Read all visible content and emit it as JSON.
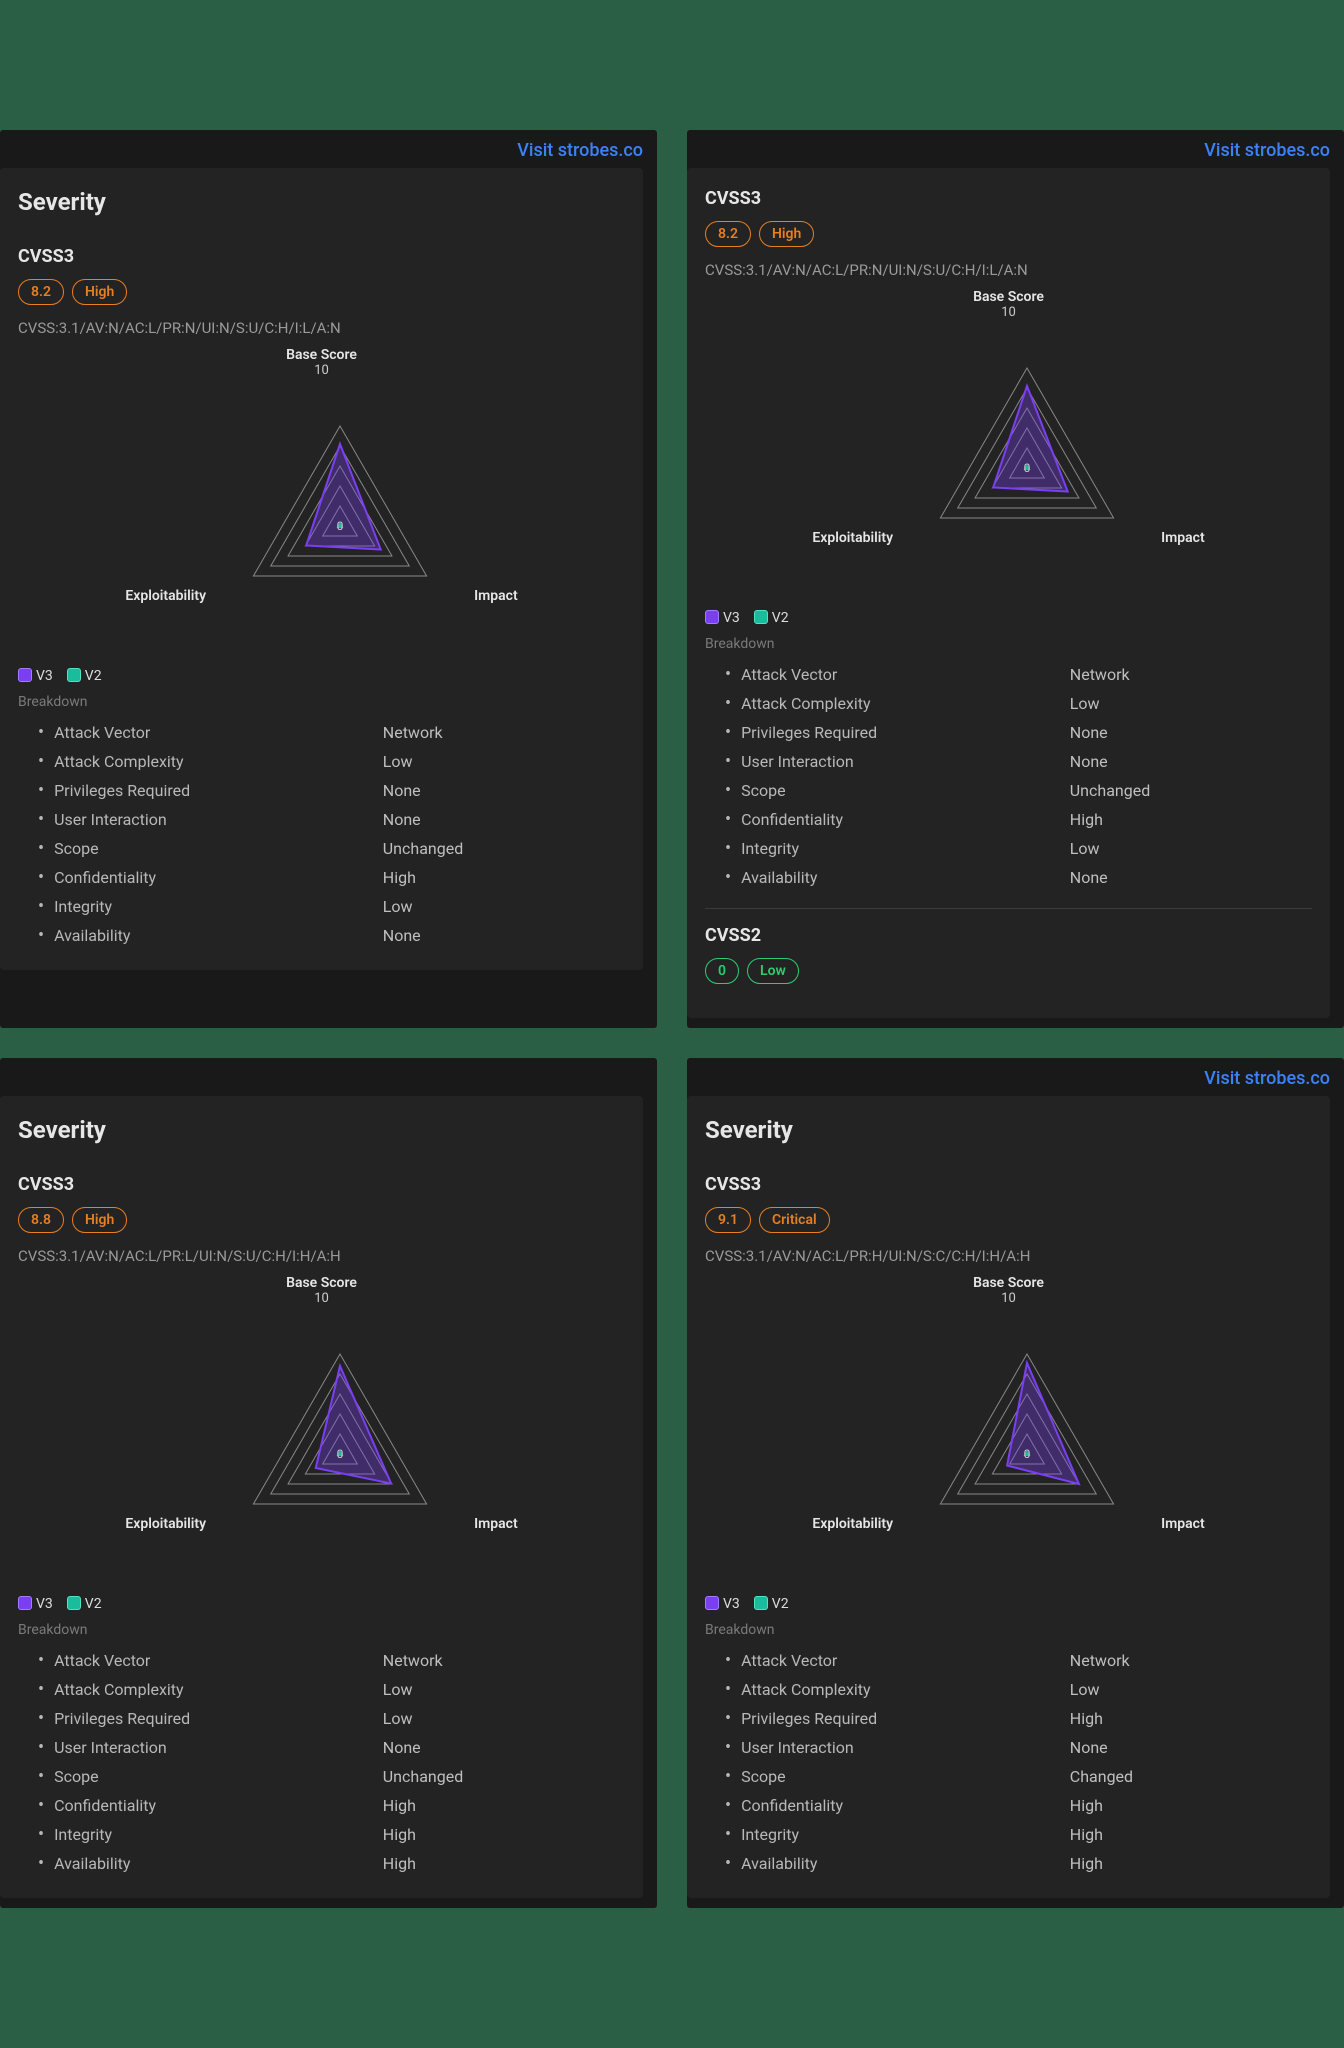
{
  "common": {
    "visit_link": "Visit strobes.co",
    "severity_title": "Severity",
    "cvss3_title": "CVSS3",
    "cvss2_title": "CVSS2",
    "breakdown_heading": "Breakdown",
    "legend_v3": "V3",
    "legend_v2": "V2",
    "radar_top_label": "Base Score",
    "radar_max": "10",
    "radar_left": "Exploitability",
    "radar_right": "Impact",
    "radar_center": "0",
    "colors": {
      "v3": "#7b3ff2",
      "v2": "#1abc9c",
      "orange": "#e67e22",
      "green": "#2ecc71"
    }
  },
  "panels": [
    {
      "show_visit": true,
      "show_severity_title": true,
      "cvss3": {
        "score": "8.2",
        "severity": "High",
        "severity_color": "orange",
        "vector": "CVSS:3.1/AV:N/AC:L/PR:N/UI:N/S:U/C:H/I:L/A:N",
        "breakdown": [
          {
            "label": "Attack Vector",
            "value": "Network"
          },
          {
            "label": "Attack Complexity",
            "value": "Low"
          },
          {
            "label": "Privileges Required",
            "value": "None"
          },
          {
            "label": "User Interaction",
            "value": "None"
          },
          {
            "label": "Scope",
            "value": "Unchanged"
          },
          {
            "label": "Confidentiality",
            "value": "High"
          },
          {
            "label": "Integrity",
            "value": "Low"
          },
          {
            "label": "Availability",
            "value": "None"
          }
        ]
      }
    },
    {
      "show_visit": true,
      "show_severity_title": false,
      "cvss3": {
        "score": "8.2",
        "severity": "High",
        "severity_color": "orange",
        "vector": "CVSS:3.1/AV:N/AC:L/PR:N/UI:N/S:U/C:H/I:L/A:N",
        "breakdown": [
          {
            "label": "Attack Vector",
            "value": "Network"
          },
          {
            "label": "Attack Complexity",
            "value": "Low"
          },
          {
            "label": "Privileges Required",
            "value": "None"
          },
          {
            "label": "User Interaction",
            "value": "None"
          },
          {
            "label": "Scope",
            "value": "Unchanged"
          },
          {
            "label": "Confidentiality",
            "value": "High"
          },
          {
            "label": "Integrity",
            "value": "Low"
          },
          {
            "label": "Availability",
            "value": "None"
          }
        ]
      },
      "cvss2": {
        "score": "0",
        "severity": "Low",
        "severity_color": "green"
      }
    },
    {
      "show_visit": false,
      "show_severity_title": true,
      "cvss3": {
        "score": "8.8",
        "severity": "High",
        "severity_color": "orange",
        "vector": "CVSS:3.1/AV:N/AC:L/PR:L/UI:N/S:U/C:H/I:H/A:H",
        "breakdown": [
          {
            "label": "Attack Vector",
            "value": "Network"
          },
          {
            "label": "Attack Complexity",
            "value": "Low"
          },
          {
            "label": "Privileges Required",
            "value": "Low"
          },
          {
            "label": "User Interaction",
            "value": "None"
          },
          {
            "label": "Scope",
            "value": "Unchanged"
          },
          {
            "label": "Confidentiality",
            "value": "High"
          },
          {
            "label": "Integrity",
            "value": "High"
          },
          {
            "label": "Availability",
            "value": "High"
          }
        ]
      }
    },
    {
      "show_visit": true,
      "show_severity_title": true,
      "cvss3": {
        "score": "9.1",
        "severity": "Critical",
        "severity_color": "orange",
        "vector": "CVSS:3.1/AV:N/AC:L/PR:H/UI:N/S:C/C:H/I:H/A:H",
        "breakdown": [
          {
            "label": "Attack Vector",
            "value": "Network"
          },
          {
            "label": "Attack Complexity",
            "value": "Low"
          },
          {
            "label": "Privileges Required",
            "value": "High"
          },
          {
            "label": "User Interaction",
            "value": "None"
          },
          {
            "label": "Scope",
            "value": "Changed"
          },
          {
            "label": "Confidentiality",
            "value": "High"
          },
          {
            "label": "Integrity",
            "value": "High"
          },
          {
            "label": "Availability",
            "value": "High"
          }
        ]
      }
    }
  ],
  "chart_data": [
    {
      "type": "radar",
      "axes": [
        "Base Score",
        "Exploitability",
        "Impact"
      ],
      "max": 10,
      "series": [
        {
          "name": "V3",
          "values": [
            8.2,
            3.9,
            4.7
          ]
        },
        {
          "name": "V2",
          "values": [
            0,
            0,
            0
          ]
        }
      ]
    },
    {
      "type": "radar",
      "axes": [
        "Base Score",
        "Exploitability",
        "Impact"
      ],
      "max": 10,
      "series": [
        {
          "name": "V3",
          "values": [
            8.2,
            3.9,
            4.7
          ]
        },
        {
          "name": "V2",
          "values": [
            0,
            0,
            0
          ]
        }
      ]
    },
    {
      "type": "radar",
      "axes": [
        "Base Score",
        "Exploitability",
        "Impact"
      ],
      "max": 10,
      "series": [
        {
          "name": "V3",
          "values": [
            8.8,
            2.8,
            5.9
          ]
        },
        {
          "name": "V2",
          "values": [
            0,
            0,
            0
          ]
        }
      ]
    },
    {
      "type": "radar",
      "axes": [
        "Base Score",
        "Exploitability",
        "Impact"
      ],
      "max": 10,
      "series": [
        {
          "name": "V3",
          "values": [
            9.1,
            2.3,
            6.0
          ]
        },
        {
          "name": "V2",
          "values": [
            0,
            0,
            0
          ]
        }
      ]
    }
  ]
}
